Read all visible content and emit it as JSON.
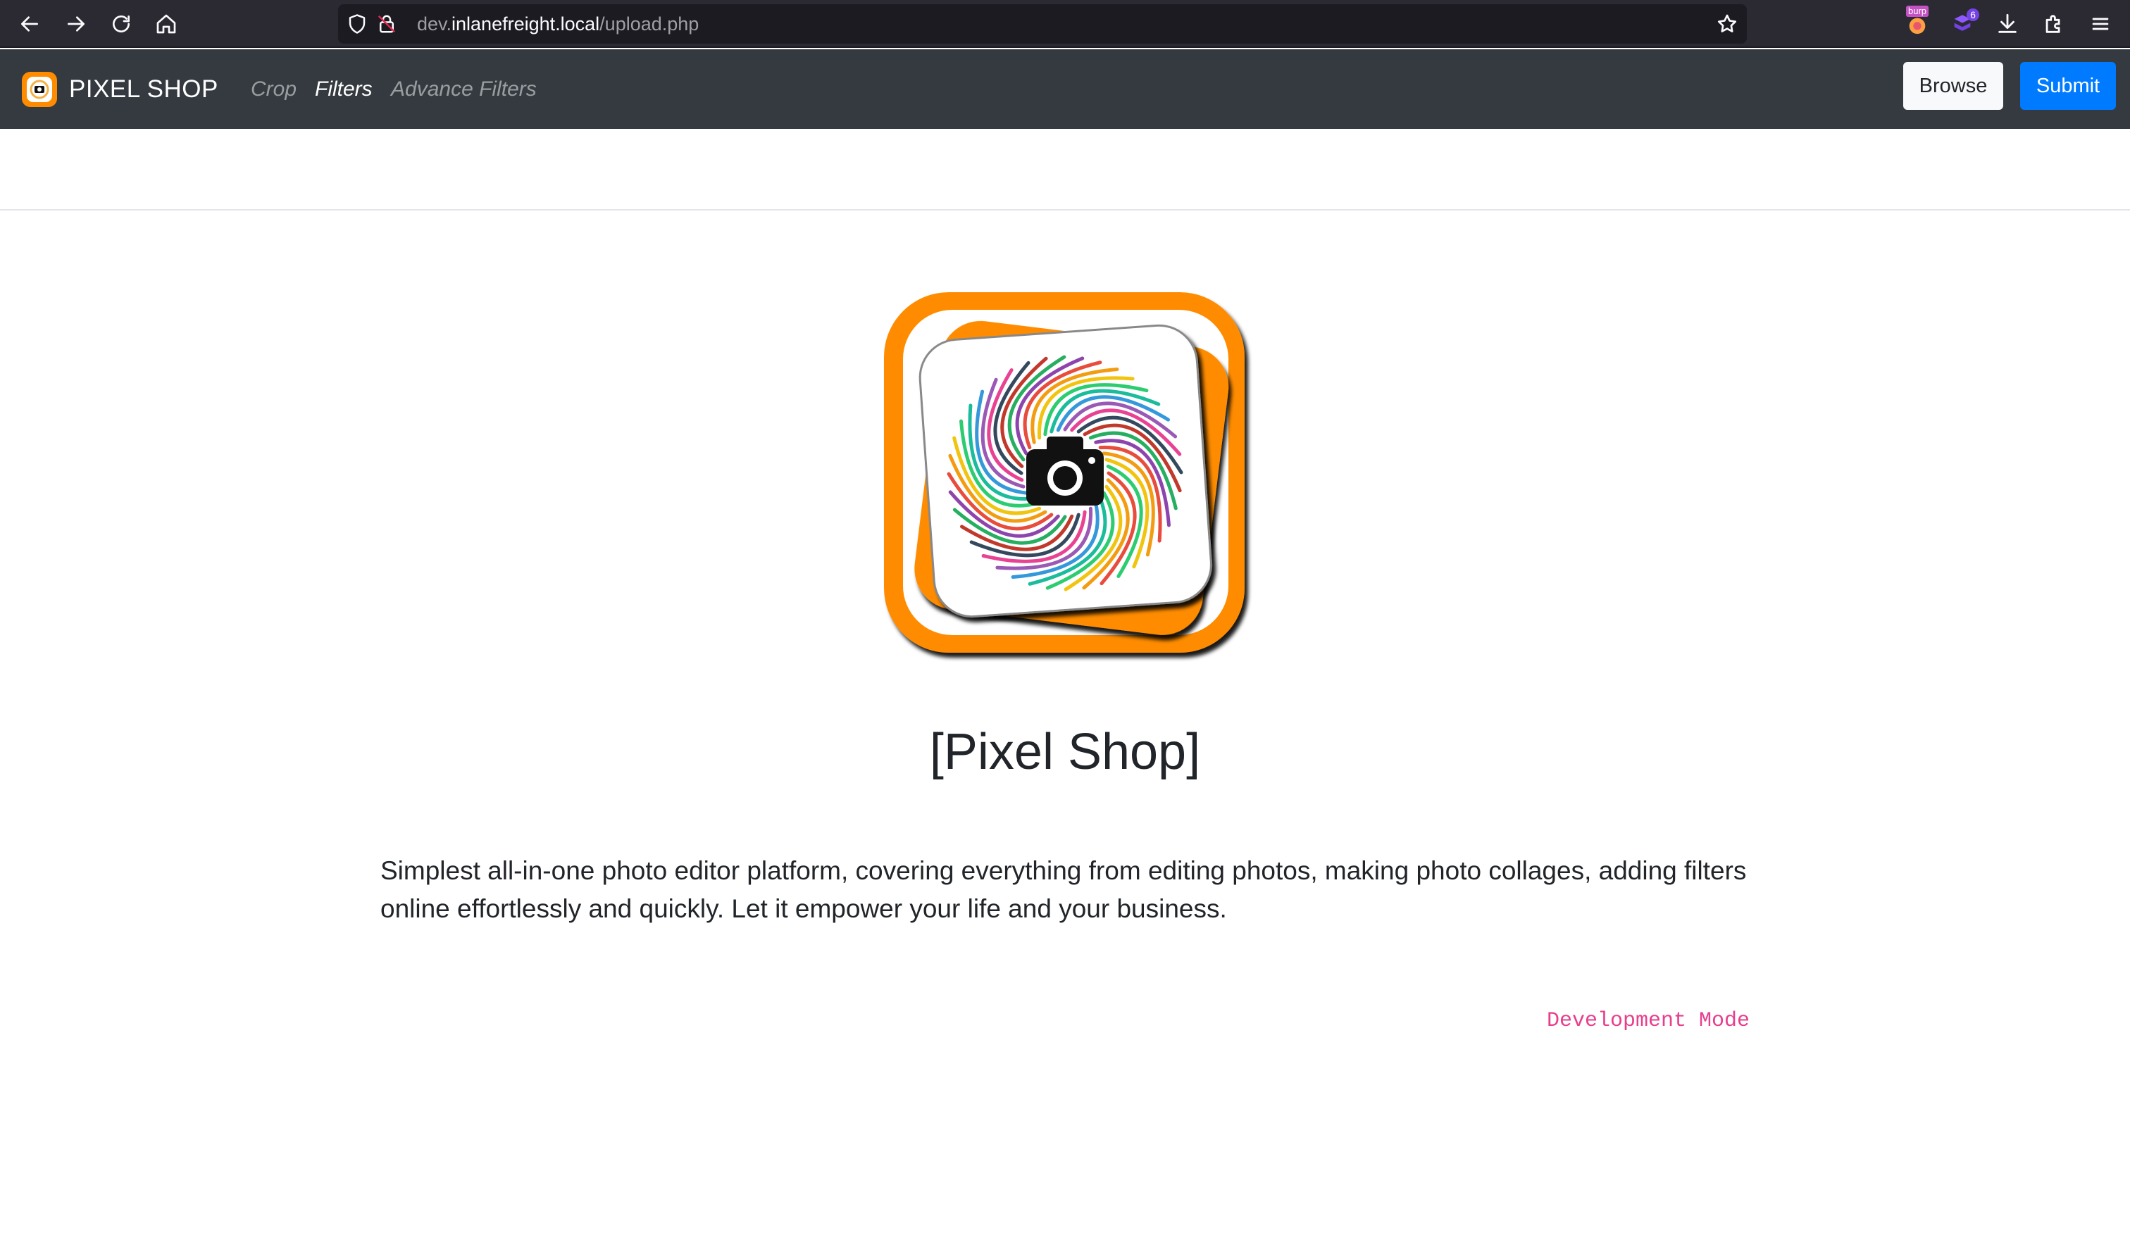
{
  "browser": {
    "url_prefix": "dev.",
    "url_host": "inlanefreight.local",
    "url_path": "/upload.php",
    "extensions": [
      {
        "name": "burp-extension-icon",
        "badge": "burp"
      },
      {
        "name": "shield-extension-icon",
        "badge": "6"
      }
    ]
  },
  "navbar": {
    "brand": "PIXEL SHOP",
    "links": [
      {
        "label": "Crop",
        "active": false
      },
      {
        "label": "Filters",
        "active": true
      },
      {
        "label": "Advance Filters",
        "active": false
      }
    ],
    "browse_label": "Browse",
    "submit_label": "Submit"
  },
  "main": {
    "title": "[Pixel Shop]",
    "description": "Simplest all-in-one photo editor platform, covering everything from editing photos, making photo collages, adding filters online effortlessly and quickly. Let it empower your life and your business.",
    "dev_mode": "Development Mode"
  },
  "colors": {
    "navbar_bg": "#343a40",
    "primary": "#007bff",
    "logo_orange": "#ff8c00",
    "dev_mode": "#e83e8c"
  }
}
